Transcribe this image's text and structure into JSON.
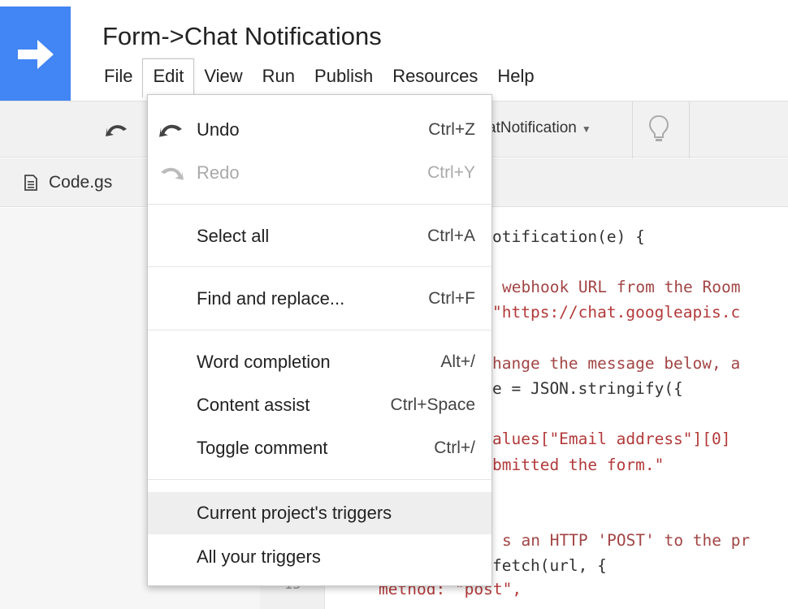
{
  "app": {
    "title": "Form->Chat Notifications"
  },
  "menubar": [
    {
      "label": "File"
    },
    {
      "label": "Edit"
    },
    {
      "label": "View"
    },
    {
      "label": "Run"
    },
    {
      "label": "Publish"
    },
    {
      "label": "Resources"
    },
    {
      "label": "Help"
    }
  ],
  "toolbar": {
    "function_select": "atNotification",
    "icons": [
      "undo-icon",
      "chevron-down-icon",
      "lightbulb-icon"
    ]
  },
  "file_tab": {
    "label": "Code.gs",
    "icon": "document-icon"
  },
  "edit_menu": {
    "items": [
      {
        "label": "Undo",
        "shortcut": "Ctrl+Z",
        "icon": "undo-icon",
        "enabled": true
      },
      {
        "label": "Redo",
        "shortcut": "Ctrl+Y",
        "icon": "redo-icon",
        "enabled": false
      },
      {
        "label": "Select all",
        "shortcut": "Ctrl+A"
      },
      {
        "label": "Find and replace...",
        "shortcut": "Ctrl+F"
      },
      {
        "label": "Word completion",
        "shortcut": "Alt+/"
      },
      {
        "label": "Content assist",
        "shortcut": "Ctrl+Space"
      },
      {
        "label": "Toggle comment",
        "shortcut": "Ctrl+/"
      },
      {
        "label": "Current project's triggers",
        "shortcut": "",
        "highlighted": true
      },
      {
        "label": "All your triggers",
        "shortcut": ""
      }
    ]
  },
  "code": {
    "visible_fragments": [
      {
        "text": "otification(e) {"
      },
      {
        "text": "webhook URL from the Room"
      },
      {
        "text": "\"https://chat.googleapis.c"
      },
      {
        "text": "hange the message below, a"
      },
      {
        "text": "e = JSON.stringify({"
      },
      {
        "text": "alues[\"Email address\"][0]"
      },
      {
        "text": "bmitted the form.\""
      },
      {
        "text": "s an HTTP 'POST' to the pr"
      },
      {
        "text": "fetch(url, {"
      },
      {
        "text": "method: \"post\","
      }
    ],
    "line_numbers": [
      "15"
    ]
  },
  "colors": {
    "logo_blue": "#4285f4",
    "toolbar_bg": "#f1f1f1",
    "menu_highlight": "#eeeeee",
    "disabled_text": "#aaaaaa",
    "string_red": "#b33a3a"
  }
}
